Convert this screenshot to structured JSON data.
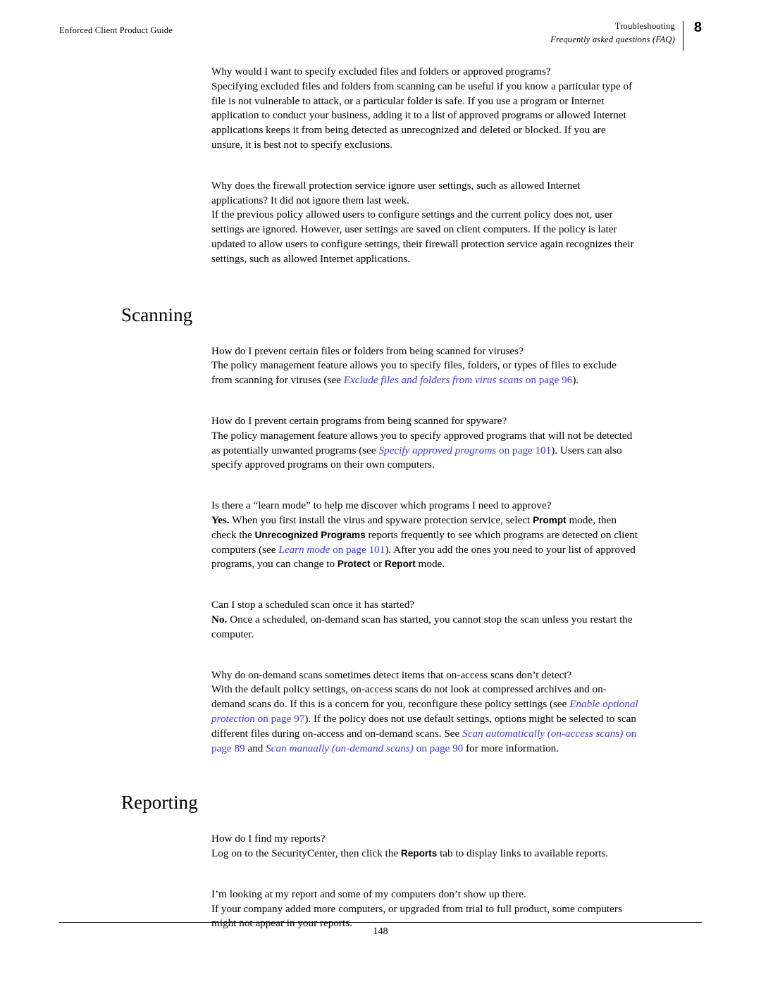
{
  "header": {
    "left_title": "Enforced Client Product Guide",
    "right_title": "Troubleshooting",
    "right_subtitle": "Frequently asked questions (FAQ)",
    "chapter_number": "8"
  },
  "footer": {
    "page_number": "148"
  },
  "body": {
    "faq1": {
      "question": "Why would I want to specify excluded files and folders or approved programs?",
      "answer": "Specifying excluded files and folders from scanning can be useful if you know a particular type of file is not vulnerable to attack, or a particular folder is safe. If you use a program or Internet application to conduct your business, adding it to a list of approved programs or allowed Internet applications keeps it from being detected as unrecognized and deleted or blocked. If you are unsure, it is best not to specify exclusions."
    },
    "faq2": {
      "question": "Why does the firewall protection service ignore user settings, such as allowed Internet applications? It did not ignore them last week.",
      "answer": "If the previous policy allowed users to configure settings and the current policy does not, user settings are ignored. However, user settings are saved on client computers. If the policy is later updated to allow users to configure settings, their firewall protection service again recognizes their settings, such as allowed Internet applications."
    },
    "scanning_heading": "Scanning",
    "faq3": {
      "question": "How do I prevent certain files or folders from being scanned for viruses?",
      "answer_a": "The policy management feature allows you to specify files, folders, or types of files to exclude from scanning for viruses (see ",
      "link": "Exclude files and folders from virus scans",
      "link_suffix": " on page 96",
      "answer_b": ")."
    },
    "faq4": {
      "question": "How do I prevent certain programs from being scanned for spyware?",
      "answer_a": "The policy management feature allows you to specify approved programs that will not be detected as potentially unwanted programs (see ",
      "link": "Specify approved programs",
      "link_suffix": " on page 101",
      "answer_b": "). Users can also specify approved programs on their own computers."
    },
    "faq5": {
      "question": "Is there a “learn mode” to help me discover which programs I need to approve?",
      "answer_yes": "Yes.",
      "answer_a": " When you first install the virus and spyware protection service, select ",
      "mode_prompt": "Prompt",
      "answer_b": " mode, then check the ",
      "report_name": "Unrecognized Programs",
      "answer_c": " reports frequently to see which programs are detected on client computers (see ",
      "link": "Learn mode",
      "link_suffix": " on page 101",
      "answer_d": "). After you add the ones you need to your list of approved programs, you can change to ",
      "mode_protect": "Protect",
      "answer_e": " or ",
      "mode_report": "Report",
      "answer_f": " mode."
    },
    "faq6": {
      "question": "Can I stop a scheduled scan once it has started?",
      "answer_no": "No.",
      "answer": " Once a scheduled, on-demand scan has started, you cannot stop the scan unless you restart the computer."
    },
    "faq7": {
      "question": "Why do on-demand scans sometimes detect items that on-access scans don’t detect?",
      "answer_a": "With the default policy settings, on-access scans do not look at compressed archives and on-demand scans do. If this is a concern for you, reconfigure these policy settings (see ",
      "link1": "Enable optional protection",
      "link1_suffix": " on page 97",
      "answer_b": "). If the policy does not use default settings, options might be selected to scan different files during on-access and on-demand scans. See ",
      "link2": "Scan automatically (on-access scans)",
      "link2_suffix": " on page 89",
      "answer_c": " and ",
      "link3": "Scan manually (on-demand scans)",
      "link3_suffix": " on page 90",
      "answer_d": " for more information."
    },
    "reporting_heading": "Reporting",
    "faq8": {
      "question": "How do I find my reports?",
      "answer_a": "Log on to the SecurityCenter, then click the ",
      "tab_name": "Reports",
      "answer_b": " tab to display links to available reports."
    },
    "faq9": {
      "question": "I’m looking at my report and some of my computers don’t show up there.",
      "answer": "If your company added more computers, or upgraded from trial to full product, some computers might not appear in your reports."
    }
  }
}
